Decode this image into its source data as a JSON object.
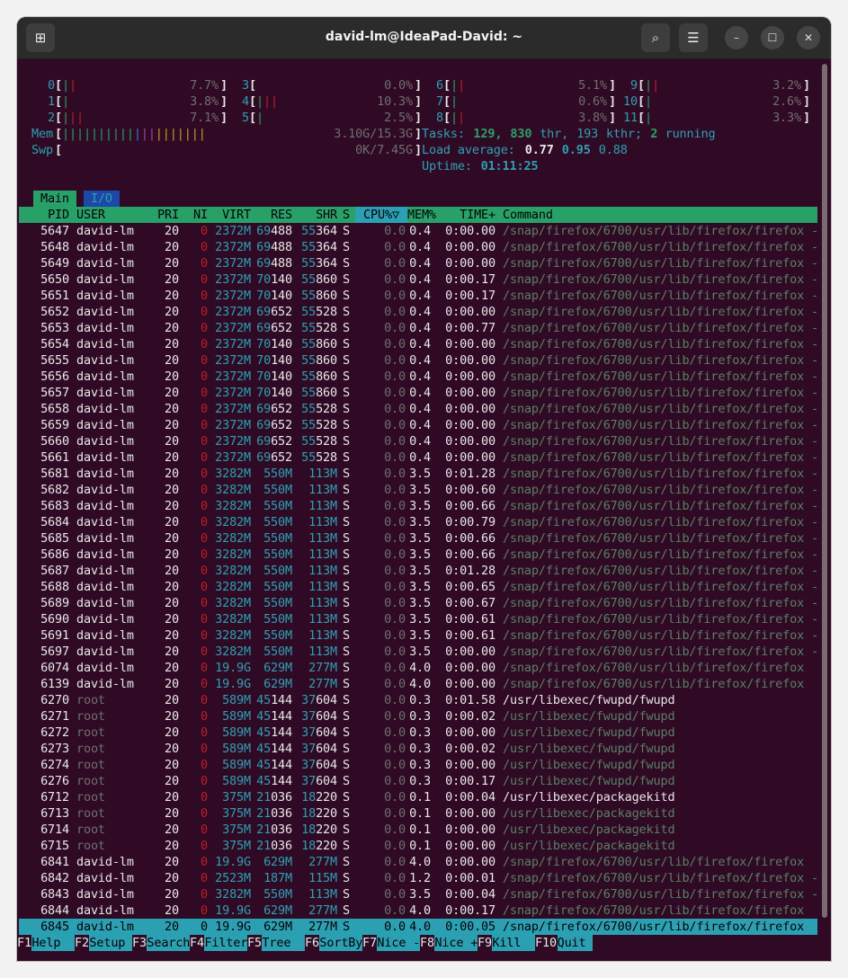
{
  "window": {
    "title": "david-lm@IdeaPad-David: ~"
  },
  "toolbar": {
    "new_tab_icon": "new-tab-icon",
    "search_icon": "search-icon",
    "menu_icon": "hamburger-icon",
    "min_icon": "minimize-icon",
    "max_icon": "maximize-icon",
    "close_icon": "close-icon"
  },
  "cpus": [
    {
      "id": "0",
      "pct": "7.7%"
    },
    {
      "id": "1",
      "pct": "3.8%"
    },
    {
      "id": "2",
      "pct": "7.1%"
    },
    {
      "id": "3",
      "pct": "0.0%"
    },
    {
      "id": "4",
      "pct": "10.3%"
    },
    {
      "id": "5",
      "pct": "2.5%"
    },
    {
      "id": "6",
      "pct": "5.1%"
    },
    {
      "id": "7",
      "pct": "0.6%"
    },
    {
      "id": "8",
      "pct": "3.8%"
    },
    {
      "id": "9",
      "pct": "3.2%"
    },
    {
      "id": "10",
      "pct": "2.6%"
    },
    {
      "id": "11",
      "pct": "3.3%"
    }
  ],
  "mem": {
    "label": "Mem",
    "value": "3.10G/15.3G"
  },
  "swp": {
    "label": "Swp",
    "value": "0K/7.45G"
  },
  "tasks": {
    "label": "Tasks:",
    "count": "129",
    "thr": "830",
    "thr_label": "thr,",
    "kthr": "193",
    "kthr_label": "kthr;",
    "running": "2",
    "running_label": "running"
  },
  "load": {
    "label": "Load average:",
    "l1": "0.77",
    "l5": "0.95",
    "l15": "0.88"
  },
  "uptime": {
    "label": "Uptime:",
    "value": "01:11:25"
  },
  "tabs": [
    {
      "label": "Main"
    },
    {
      "label": "I/O"
    }
  ],
  "columns": {
    "pid": "PID",
    "user": "USER",
    "pri": "PRI",
    "ni": "NI",
    "virt": "VIRT",
    "res": "RES",
    "shr": "SHR",
    "s": "S",
    "cpu": "CPU%▽",
    "mem": "MEM%",
    "time": "TIME+",
    "command": "Command"
  },
  "processes": [
    [
      "5647",
      "david-lm",
      "20",
      "0",
      "2372M",
      "69488",
      "55364",
      "S",
      "0.0",
      "0.4",
      "0:00.00",
      "/snap/firefox/6700/usr/lib/firefox/firefox -"
    ],
    [
      "5648",
      "david-lm",
      "20",
      "0",
      "2372M",
      "69488",
      "55364",
      "S",
      "0.0",
      "0.4",
      "0:00.00",
      "/snap/firefox/6700/usr/lib/firefox/firefox -"
    ],
    [
      "5649",
      "david-lm",
      "20",
      "0",
      "2372M",
      "69488",
      "55364",
      "S",
      "0.0",
      "0.4",
      "0:00.00",
      "/snap/firefox/6700/usr/lib/firefox/firefox -"
    ],
    [
      "5650",
      "david-lm",
      "20",
      "0",
      "2372M",
      "70140",
      "55860",
      "S",
      "0.0",
      "0.4",
      "0:00.17",
      "/snap/firefox/6700/usr/lib/firefox/firefox -"
    ],
    [
      "5651",
      "david-lm",
      "20",
      "0",
      "2372M",
      "70140",
      "55860",
      "S",
      "0.0",
      "0.4",
      "0:00.17",
      "/snap/firefox/6700/usr/lib/firefox/firefox -"
    ],
    [
      "5652",
      "david-lm",
      "20",
      "0",
      "2372M",
      "69652",
      "55528",
      "S",
      "0.0",
      "0.4",
      "0:00.00",
      "/snap/firefox/6700/usr/lib/firefox/firefox -"
    ],
    [
      "5653",
      "david-lm",
      "20",
      "0",
      "2372M",
      "69652",
      "55528",
      "S",
      "0.0",
      "0.4",
      "0:00.77",
      "/snap/firefox/6700/usr/lib/firefox/firefox -"
    ],
    [
      "5654",
      "david-lm",
      "20",
      "0",
      "2372M",
      "70140",
      "55860",
      "S",
      "0.0",
      "0.4",
      "0:00.00",
      "/snap/firefox/6700/usr/lib/firefox/firefox -"
    ],
    [
      "5655",
      "david-lm",
      "20",
      "0",
      "2372M",
      "70140",
      "55860",
      "S",
      "0.0",
      "0.4",
      "0:00.00",
      "/snap/firefox/6700/usr/lib/firefox/firefox -"
    ],
    [
      "5656",
      "david-lm",
      "20",
      "0",
      "2372M",
      "70140",
      "55860",
      "S",
      "0.0",
      "0.4",
      "0:00.00",
      "/snap/firefox/6700/usr/lib/firefox/firefox -"
    ],
    [
      "5657",
      "david-lm",
      "20",
      "0",
      "2372M",
      "70140",
      "55860",
      "S",
      "0.0",
      "0.4",
      "0:00.00",
      "/snap/firefox/6700/usr/lib/firefox/firefox -"
    ],
    [
      "5658",
      "david-lm",
      "20",
      "0",
      "2372M",
      "69652",
      "55528",
      "S",
      "0.0",
      "0.4",
      "0:00.00",
      "/snap/firefox/6700/usr/lib/firefox/firefox -"
    ],
    [
      "5659",
      "david-lm",
      "20",
      "0",
      "2372M",
      "69652",
      "55528",
      "S",
      "0.0",
      "0.4",
      "0:00.00",
      "/snap/firefox/6700/usr/lib/firefox/firefox -"
    ],
    [
      "5660",
      "david-lm",
      "20",
      "0",
      "2372M",
      "69652",
      "55528",
      "S",
      "0.0",
      "0.4",
      "0:00.00",
      "/snap/firefox/6700/usr/lib/firefox/firefox -"
    ],
    [
      "5661",
      "david-lm",
      "20",
      "0",
      "2372M",
      "69652",
      "55528",
      "S",
      "0.0",
      "0.4",
      "0:00.00",
      "/snap/firefox/6700/usr/lib/firefox/firefox -"
    ],
    [
      "5681",
      "david-lm",
      "20",
      "0",
      "3282M",
      "550M",
      "113M",
      "S",
      "0.0",
      "3.5",
      "0:01.28",
      "/snap/firefox/6700/usr/lib/firefox/firefox -"
    ],
    [
      "5682",
      "david-lm",
      "20",
      "0",
      "3282M",
      "550M",
      "113M",
      "S",
      "0.0",
      "3.5",
      "0:00.60",
      "/snap/firefox/6700/usr/lib/firefox/firefox -"
    ],
    [
      "5683",
      "david-lm",
      "20",
      "0",
      "3282M",
      "550M",
      "113M",
      "S",
      "0.0",
      "3.5",
      "0:00.66",
      "/snap/firefox/6700/usr/lib/firefox/firefox -"
    ],
    [
      "5684",
      "david-lm",
      "20",
      "0",
      "3282M",
      "550M",
      "113M",
      "S",
      "0.0",
      "3.5",
      "0:00.79",
      "/snap/firefox/6700/usr/lib/firefox/firefox -"
    ],
    [
      "5685",
      "david-lm",
      "20",
      "0",
      "3282M",
      "550M",
      "113M",
      "S",
      "0.0",
      "3.5",
      "0:00.66",
      "/snap/firefox/6700/usr/lib/firefox/firefox -"
    ],
    [
      "5686",
      "david-lm",
      "20",
      "0",
      "3282M",
      "550M",
      "113M",
      "S",
      "0.0",
      "3.5",
      "0:00.66",
      "/snap/firefox/6700/usr/lib/firefox/firefox -"
    ],
    [
      "5687",
      "david-lm",
      "20",
      "0",
      "3282M",
      "550M",
      "113M",
      "S",
      "0.0",
      "3.5",
      "0:01.28",
      "/snap/firefox/6700/usr/lib/firefox/firefox -"
    ],
    [
      "5688",
      "david-lm",
      "20",
      "0",
      "3282M",
      "550M",
      "113M",
      "S",
      "0.0",
      "3.5",
      "0:00.65",
      "/snap/firefox/6700/usr/lib/firefox/firefox -"
    ],
    [
      "5689",
      "david-lm",
      "20",
      "0",
      "3282M",
      "550M",
      "113M",
      "S",
      "0.0",
      "3.5",
      "0:00.67",
      "/snap/firefox/6700/usr/lib/firefox/firefox -"
    ],
    [
      "5690",
      "david-lm",
      "20",
      "0",
      "3282M",
      "550M",
      "113M",
      "S",
      "0.0",
      "3.5",
      "0:00.61",
      "/snap/firefox/6700/usr/lib/firefox/firefox -"
    ],
    [
      "5691",
      "david-lm",
      "20",
      "0",
      "3282M",
      "550M",
      "113M",
      "S",
      "0.0",
      "3.5",
      "0:00.61",
      "/snap/firefox/6700/usr/lib/firefox/firefox -"
    ],
    [
      "5697",
      "david-lm",
      "20",
      "0",
      "3282M",
      "550M",
      "113M",
      "S",
      "0.0",
      "3.5",
      "0:00.00",
      "/snap/firefox/6700/usr/lib/firefox/firefox -"
    ],
    [
      "6074",
      "david-lm",
      "20",
      "0",
      "19.9G",
      "629M",
      "277M",
      "S",
      "0.0",
      "4.0",
      "0:00.00",
      "/snap/firefox/6700/usr/lib/firefox/firefox"
    ],
    [
      "6139",
      "david-lm",
      "20",
      "0",
      "19.9G",
      "629M",
      "277M",
      "S",
      "0.0",
      "4.0",
      "0:00.00",
      "/snap/firefox/6700/usr/lib/firefox/firefox"
    ],
    [
      "6270",
      "root",
      "20",
      "0",
      "589M",
      "45144",
      "37604",
      "S",
      "0.0",
      "0.3",
      "0:01.58",
      "/usr/libexec/fwupd/fwupd"
    ],
    [
      "6271",
      "root",
      "20",
      "0",
      "589M",
      "45144",
      "37604",
      "S",
      "0.0",
      "0.3",
      "0:00.02",
      "/usr/libexec/fwupd/fwupd"
    ],
    [
      "6272",
      "root",
      "20",
      "0",
      "589M",
      "45144",
      "37604",
      "S",
      "0.0",
      "0.3",
      "0:00.00",
      "/usr/libexec/fwupd/fwupd"
    ],
    [
      "6273",
      "root",
      "20",
      "0",
      "589M",
      "45144",
      "37604",
      "S",
      "0.0",
      "0.3",
      "0:00.02",
      "/usr/libexec/fwupd/fwupd"
    ],
    [
      "6274",
      "root",
      "20",
      "0",
      "589M",
      "45144",
      "37604",
      "S",
      "0.0",
      "0.3",
      "0:00.00",
      "/usr/libexec/fwupd/fwupd"
    ],
    [
      "6276",
      "root",
      "20",
      "0",
      "589M",
      "45144",
      "37604",
      "S",
      "0.0",
      "0.3",
      "0:00.17",
      "/usr/libexec/fwupd/fwupd"
    ],
    [
      "6712",
      "root",
      "20",
      "0",
      "375M",
      "21036",
      "18220",
      "S",
      "0.0",
      "0.1",
      "0:00.04",
      "/usr/libexec/packagekitd"
    ],
    [
      "6713",
      "root",
      "20",
      "0",
      "375M",
      "21036",
      "18220",
      "S",
      "0.0",
      "0.1",
      "0:00.00",
      "/usr/libexec/packagekitd"
    ],
    [
      "6714",
      "root",
      "20",
      "0",
      "375M",
      "21036",
      "18220",
      "S",
      "0.0",
      "0.1",
      "0:00.00",
      "/usr/libexec/packagekitd"
    ],
    [
      "6715",
      "root",
      "20",
      "0",
      "375M",
      "21036",
      "18220",
      "S",
      "0.0",
      "0.1",
      "0:00.00",
      "/usr/libexec/packagekitd"
    ],
    [
      "6841",
      "david-lm",
      "20",
      "0",
      "19.9G",
      "629M",
      "277M",
      "S",
      "0.0",
      "4.0",
      "0:00.00",
      "/snap/firefox/6700/usr/lib/firefox/firefox"
    ],
    [
      "6842",
      "david-lm",
      "20",
      "0",
      "2523M",
      "187M",
      "115M",
      "S",
      "0.0",
      "1.2",
      "0:00.01",
      "/snap/firefox/6700/usr/lib/firefox/firefox -"
    ],
    [
      "6843",
      "david-lm",
      "20",
      "0",
      "3282M",
      "550M",
      "113M",
      "S",
      "0.0",
      "3.5",
      "0:00.04",
      "/snap/firefox/6700/usr/lib/firefox/firefox -"
    ],
    [
      "6844",
      "david-lm",
      "20",
      "0",
      "19.9G",
      "629M",
      "277M",
      "S",
      "0.0",
      "4.0",
      "0:00.17",
      "/snap/firefox/6700/usr/lib/firefox/firefox"
    ],
    [
      "6845",
      "david-lm",
      "20",
      "0",
      "19.9G",
      "629M",
      "277M",
      "S",
      "0.0",
      "4.0",
      "0:00.05",
      "/snap/firefox/6700/usr/lib/firefox/firefox"
    ]
  ],
  "selected_pid": "6845",
  "fkeys": [
    {
      "key": "F1",
      "label": "Help"
    },
    {
      "key": "F2",
      "label": "Setup"
    },
    {
      "key": "F3",
      "label": "Search"
    },
    {
      "key": "F4",
      "label": "Filter"
    },
    {
      "key": "F5",
      "label": "Tree"
    },
    {
      "key": "F6",
      "label": "SortBy"
    },
    {
      "key": "F7",
      "label": "Nice -"
    },
    {
      "key": "F8",
      "label": "Nice +"
    },
    {
      "key": "F9",
      "label": "Kill"
    },
    {
      "key": "F10",
      "label": "Quit"
    }
  ],
  "colors": {
    "bg": "#300a24",
    "green": "#26a269",
    "teal": "#2aa1b3",
    "red": "#c01c28"
  }
}
